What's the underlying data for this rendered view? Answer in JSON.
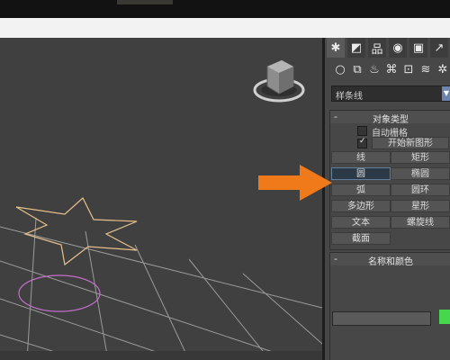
{
  "panel": {
    "tabs": [
      {
        "icon": "create-star-icon",
        "glyph": "✱"
      },
      {
        "icon": "modify-icon",
        "glyph": "◩"
      },
      {
        "icon": "hierarchy-icon",
        "glyph": "品"
      },
      {
        "icon": "motion-icon",
        "glyph": "◉"
      },
      {
        "icon": "display-icon",
        "glyph": "▣"
      },
      {
        "icon": "utilities-icon",
        "glyph": "↗"
      }
    ],
    "category_icons": [
      {
        "icon": "geometry-icon",
        "glyph": "○"
      },
      {
        "icon": "shapes-icon",
        "glyph": "⧉"
      },
      {
        "icon": "lights-icon",
        "glyph": "♨"
      },
      {
        "icon": "cameras-icon",
        "glyph": "⌘"
      },
      {
        "icon": "helpers-icon",
        "glyph": "⊡"
      },
      {
        "icon": "space-warps-icon",
        "glyph": "≋"
      },
      {
        "icon": "systems-icon",
        "glyph": "✲"
      }
    ],
    "category_dropdown": "样条线",
    "object_type": {
      "title": "对象类型",
      "minus": "-",
      "autogrid_label": "自动栅格",
      "autogrid_checked": false,
      "start_new_shape_checked": true,
      "start_new_shape_label": "开始新图形",
      "buttons": [
        "线",
        "矩形",
        "圆",
        "椭圆",
        "弧",
        "圆环",
        "多边形",
        "星形",
        "文本",
        "螺旋线",
        "截面"
      ],
      "selected": "圆"
    },
    "name_color": {
      "title": "名称和颜色",
      "minus": "-",
      "name_value": "",
      "color": "#46d74e"
    }
  },
  "viewport": {
    "star_color": "#e6c08a",
    "circle_color": "#c36fcb",
    "grid_color": "#9a9a9a"
  },
  "annotation": {
    "arrow_color": "#f07a1a"
  }
}
